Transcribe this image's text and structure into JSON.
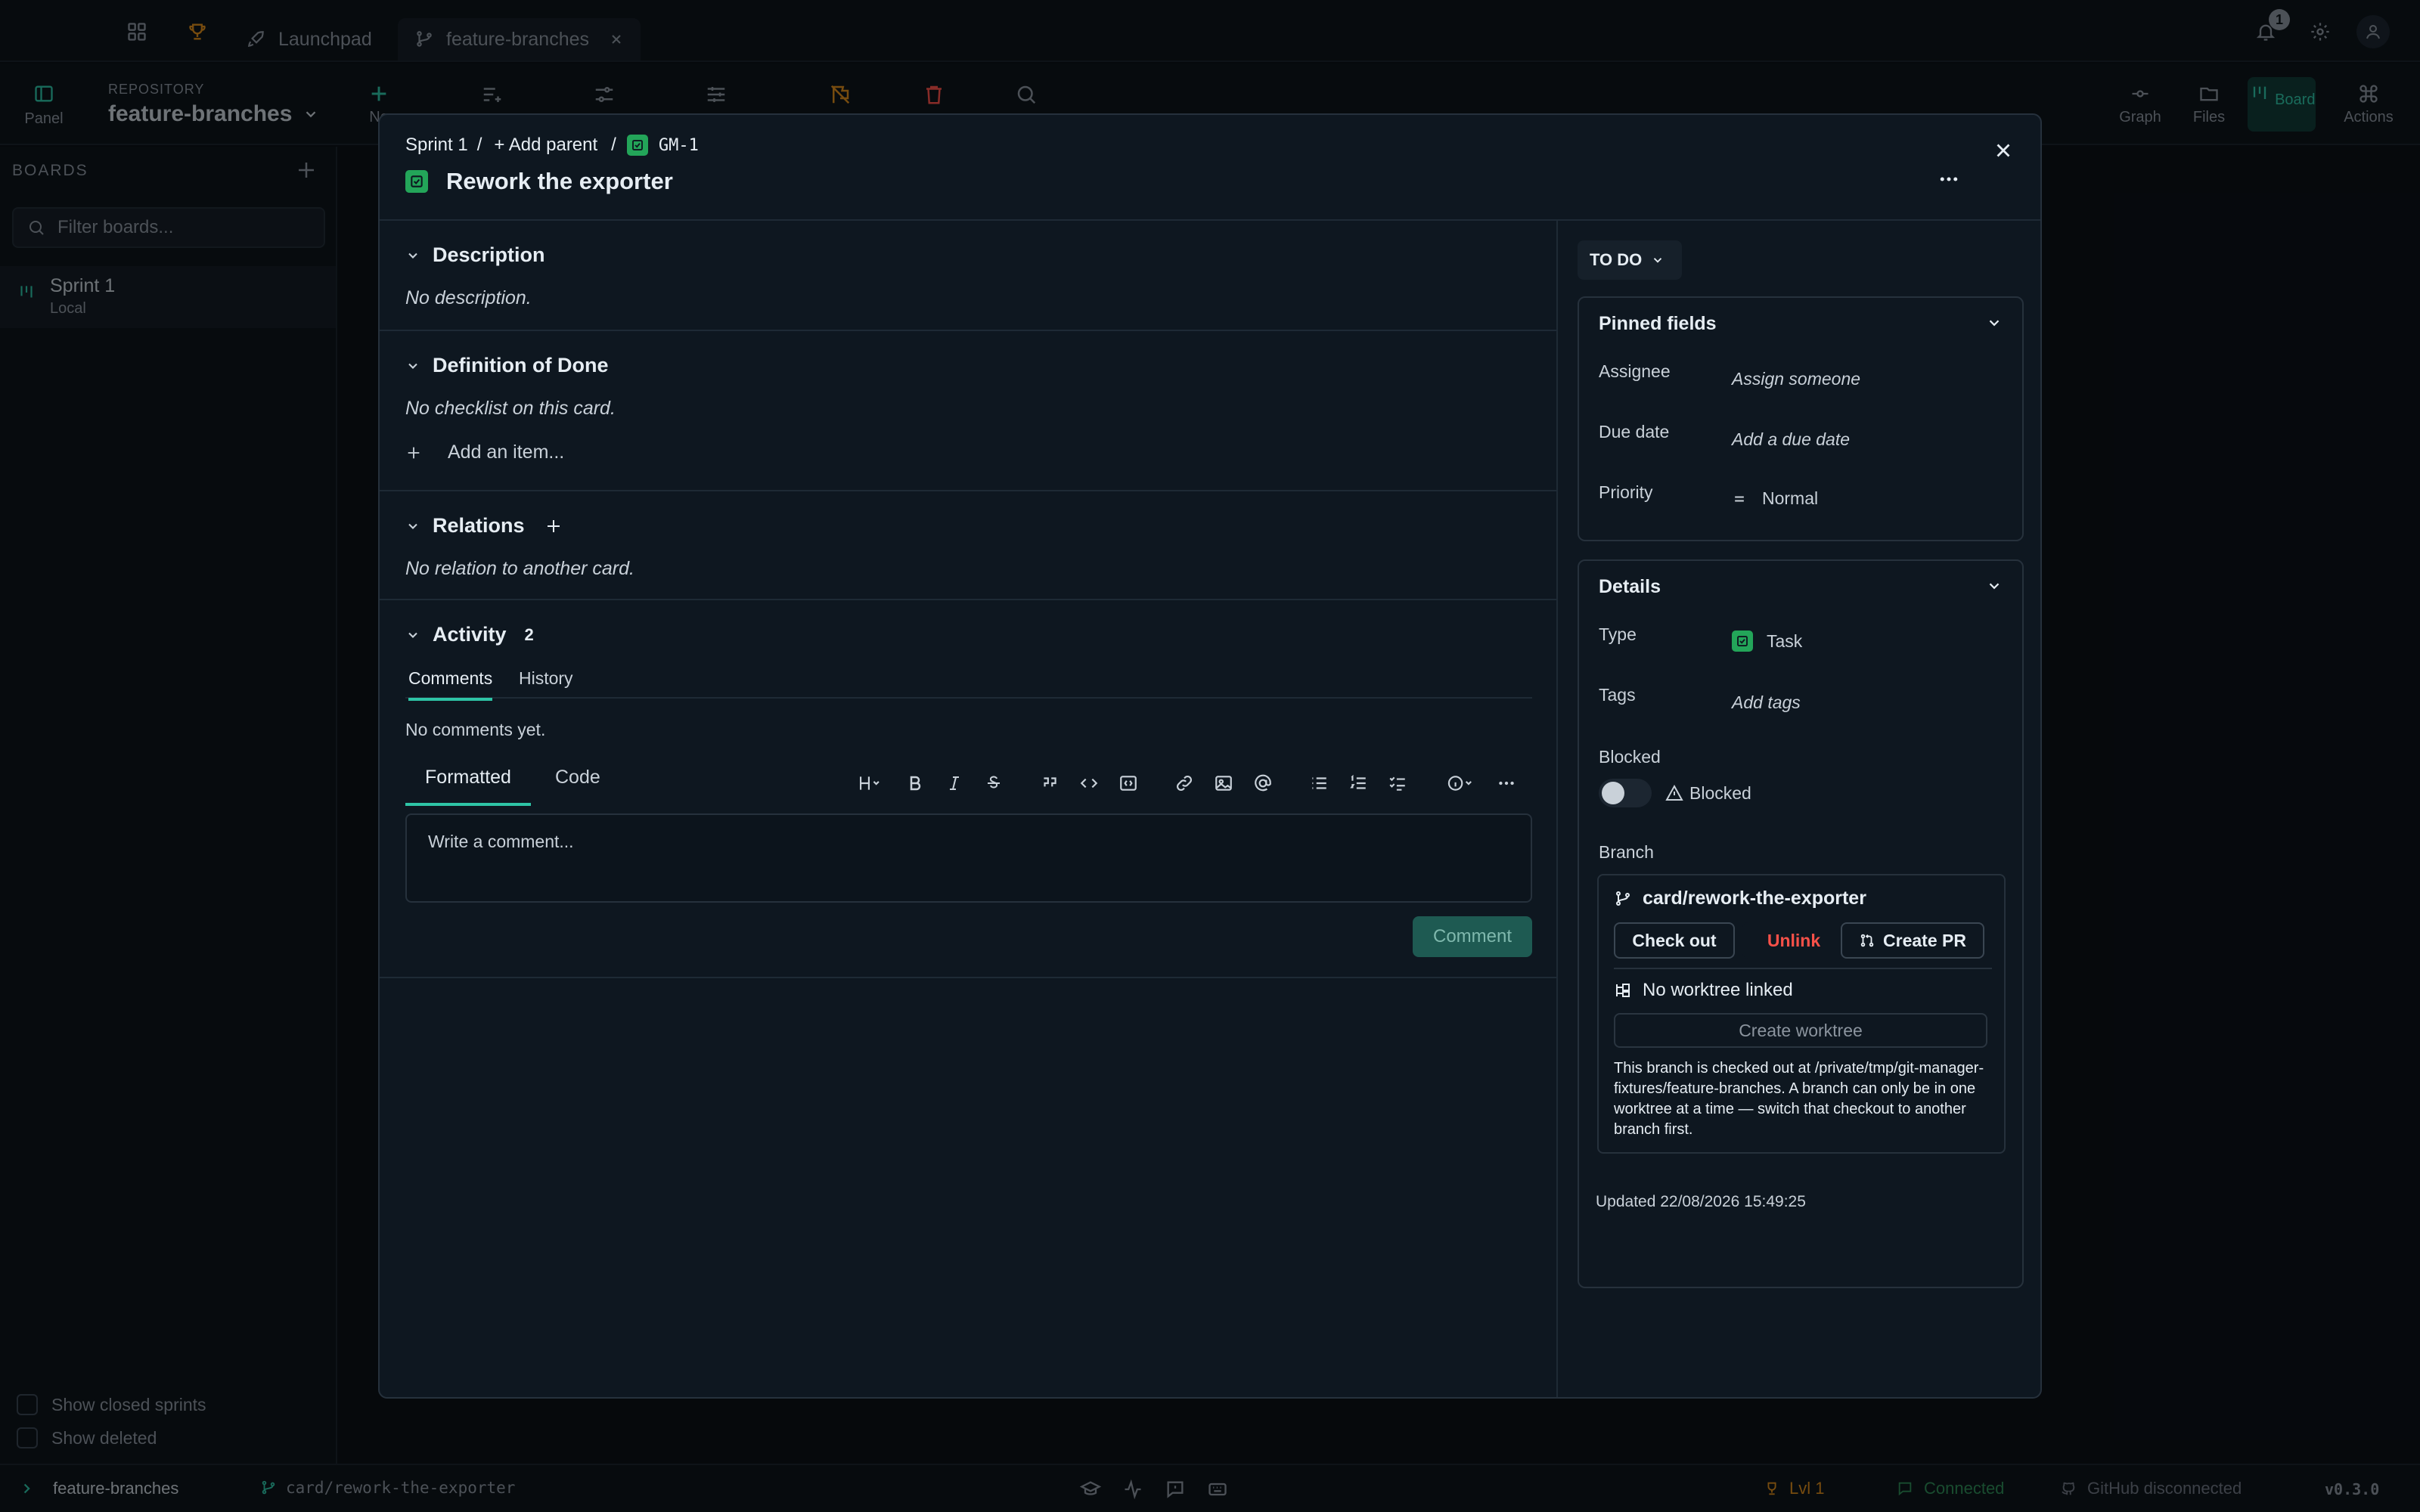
{
  "tabbar": {
    "tabs": [
      {
        "label": "Launchpad"
      },
      {
        "label": "feature-branches"
      }
    ],
    "notification_count": "1"
  },
  "toolbar": {
    "panel_label": "Panel",
    "repo_caption": "REPOSITORY",
    "repo_name": "feature-branches",
    "new_label": "Ne",
    "right": [
      {
        "label": "Graph"
      },
      {
        "label": "Files"
      },
      {
        "label": "Board"
      },
      {
        "label": "Actions"
      }
    ]
  },
  "sidebar": {
    "title": "BOARDS",
    "filter_placeholder": "Filter boards...",
    "boards": [
      {
        "name": "Sprint 1",
        "sub": "Local"
      }
    ],
    "show_closed": "Show closed sprints",
    "show_deleted": "Show deleted"
  },
  "statusbar": {
    "repo": "feature-branches",
    "branch": "card/rework-the-exporter",
    "level": "Lvl 1",
    "connected": "Connected",
    "github": "GitHub disconnected",
    "version": "v0.3.0"
  },
  "modal": {
    "breadcrumb": {
      "sprint": "Sprint 1",
      "sep": "/",
      "add_parent": "+ Add parent",
      "card_id": "GM-1"
    },
    "title": "Rework the exporter",
    "description": {
      "heading": "Description",
      "empty": "No description."
    },
    "dod": {
      "heading": "Definition of Done",
      "empty": "No checklist on this card.",
      "add_item": "Add an item..."
    },
    "relations": {
      "heading": "Relations",
      "empty": "No relation to another card."
    },
    "activity": {
      "heading": "Activity",
      "count": "2",
      "tabs": [
        {
          "label": "Comments"
        },
        {
          "label": "History"
        }
      ],
      "no_comments": "No comments yet.",
      "editor_tabs": [
        {
          "label": "Formatted"
        },
        {
          "label": "Code"
        }
      ],
      "comment_placeholder": "Write a comment...",
      "comment_button": "Comment"
    },
    "status": "TO DO",
    "pinned": {
      "heading": "Pinned fields",
      "assignee_label": "Assignee",
      "assignee_value": "Assign someone",
      "due_label": "Due date",
      "due_value": "Add a due date",
      "priority_label": "Priority",
      "priority_value": "Normal"
    },
    "details": {
      "heading": "Details",
      "type_label": "Type",
      "type_value": "Task",
      "tags_label": "Tags",
      "tags_value": "Add tags",
      "blocked_label": "Blocked",
      "blocked_toggle": "Blocked",
      "blocked": false,
      "branch_label": "Branch",
      "branch_name": "card/rework-the-exporter",
      "checkout": "Check out",
      "unlink": "Unlink",
      "create_pr": "Create PR",
      "worktree_status": "No worktree linked",
      "create_worktree": "Create worktree",
      "note": "This branch is checked out at /private/tmp/git-manager-fixtures/feature-branches. A branch can only be in one worktree at a time — switch that checkout to another branch first."
    },
    "updated": "Updated 22/08/2026 15:49:25"
  },
  "colors": {
    "accent": "#2ec4a6",
    "task_green": "#23a559",
    "danger": "#f85149",
    "level": "#d98a1c",
    "connected": "#2e8b57"
  }
}
